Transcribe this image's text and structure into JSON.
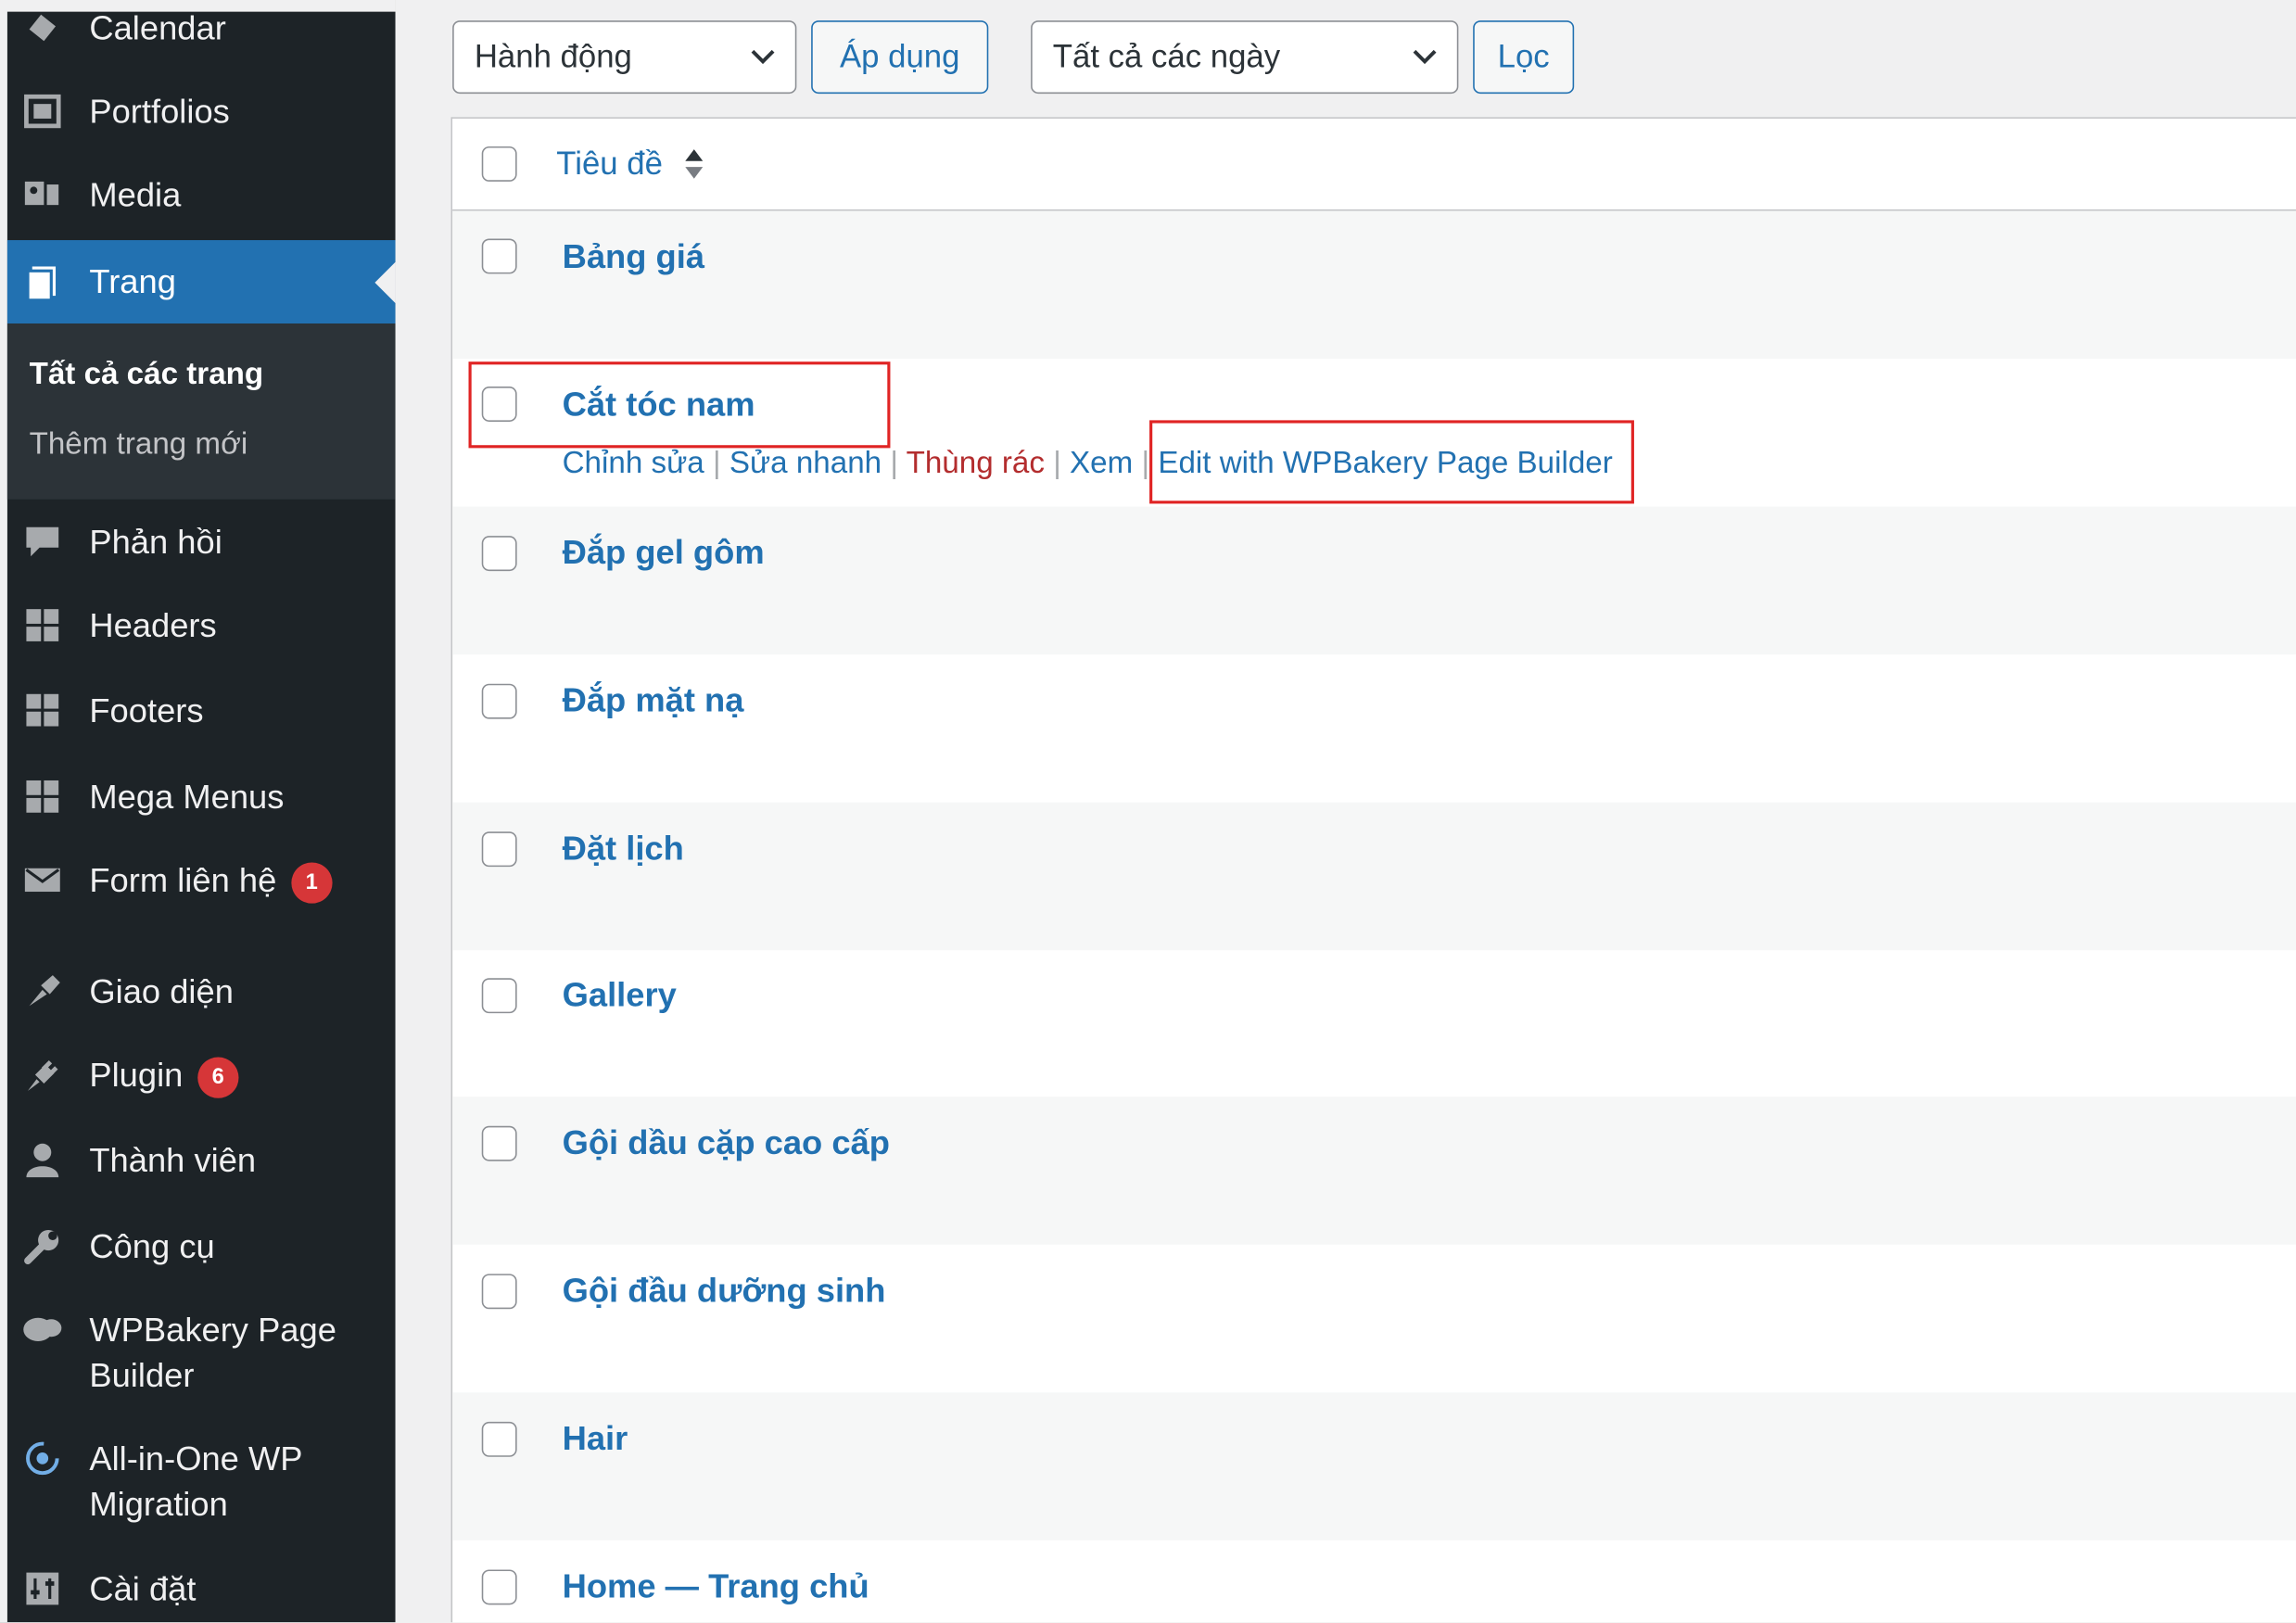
{
  "sidebar": {
    "items": [
      {
        "label": "Calendar",
        "icon": "calendar-icon"
      },
      {
        "label": "Portfolios",
        "icon": "portfolio-icon"
      },
      {
        "label": "Media",
        "icon": "media-icon"
      },
      {
        "label": "Trang",
        "icon": "pages-icon",
        "active": true
      },
      {
        "label": "Phản hồi",
        "icon": "comments-icon"
      },
      {
        "label": "Headers",
        "icon": "grid-icon"
      },
      {
        "label": "Footers",
        "icon": "grid-icon"
      },
      {
        "label": "Mega Menus",
        "icon": "grid-icon"
      },
      {
        "label": "Form liên hệ",
        "icon": "mail-icon",
        "badge": "1"
      },
      {
        "label": "Giao diện",
        "icon": "brush-icon"
      },
      {
        "label": "Plugin",
        "icon": "plugin-icon",
        "badge": "6"
      },
      {
        "label": "Thành viên",
        "icon": "user-icon"
      },
      {
        "label": "Công cụ",
        "icon": "wrench-icon"
      },
      {
        "label": "WPBakery Page Builder",
        "icon": "wpbakery-icon"
      },
      {
        "label": "All-in-One WP Migration",
        "icon": "migration-icon"
      },
      {
        "label": "Cài đặt",
        "icon": "settings-icon"
      }
    ],
    "submenu": [
      {
        "label": "Tất cả các trang",
        "current": true
      },
      {
        "label": "Thêm trang mới"
      }
    ]
  },
  "toolbar": {
    "bulk_action": "Hành động",
    "apply_label": "Áp dụng",
    "date_filter": "Tất cả các ngày",
    "filter_label": "Lọc"
  },
  "table": {
    "column_title": "Tiêu đề",
    "rows": [
      {
        "title": "Bảng giá"
      },
      {
        "title": "Cắt tóc nam"
      },
      {
        "title": "Đắp gel gôm"
      },
      {
        "title": "Đắp mặt nạ"
      },
      {
        "title": "Đặt lịch"
      },
      {
        "title": "Gallery"
      },
      {
        "title": "Gội dầu cặp cao cấp"
      },
      {
        "title": "Gội đầu dưỡng sinh"
      },
      {
        "title": "Hair"
      },
      {
        "title": "Home — Trang chủ"
      }
    ],
    "row_actions": {
      "edit": "Chỉnh sửa",
      "quick_edit": "Sửa nhanh",
      "trash": "Thùng rác",
      "view": "Xem",
      "wpbakery": "Edit with WPBakery Page Builder",
      "separator": "|"
    }
  },
  "colors": {
    "sidebar_bg": "#1d2327",
    "accent": "#2271b1",
    "highlight": "#e02424",
    "badge": "#d63638"
  }
}
